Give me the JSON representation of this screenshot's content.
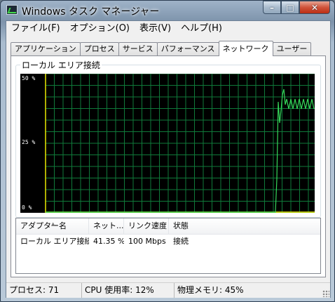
{
  "window": {
    "title": "Windows タスク マネージャー",
    "controls": {
      "minimize": "–",
      "maximize": "□",
      "close": "✕"
    }
  },
  "menubar": [
    "ファイル(F)",
    "オプション(O)",
    "表示(V)",
    "ヘルプ(H)"
  ],
  "tabs": [
    "アプリケーション",
    "プロセス",
    "サービス",
    "パフォーマンス",
    "ネットワーク",
    "ユーザー"
  ],
  "active_tab": "ネットワーク",
  "network_graph": {
    "label": "ローカル エリア接続",
    "y_ticks": [
      "50 %",
      "25 %",
      "0 %"
    ],
    "line_color": "#35d85a",
    "grid_color": "#0f7a3a"
  },
  "adapters": {
    "columns": [
      "アダプター名",
      "ネット...",
      "リンク速度",
      "状態"
    ],
    "rows": [
      {
        "name": "ローカル エリア接続",
        "utilization": "41.35 %",
        "link_speed": "100 Mbps",
        "state": "接続"
      }
    ]
  },
  "statusbar": {
    "processes": "プロセス: 71",
    "cpu": "CPU 使用率: 12%",
    "memory": "物理メモリ: 45%"
  }
}
